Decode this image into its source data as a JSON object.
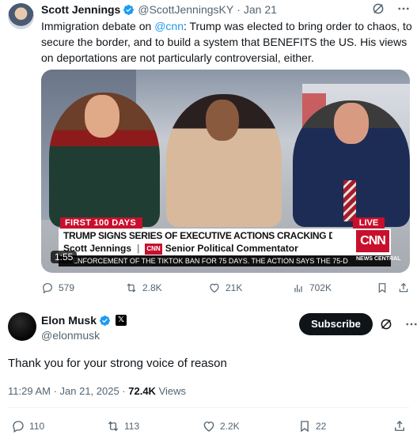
{
  "parent_tweet": {
    "name": "Scott Jennings",
    "handle": "@ScottJenningsKY",
    "separator": "·",
    "date": "Jan 21",
    "text_before_mention": "Immigration debate on ",
    "mention": "@cnn",
    "text_after_mention": ": Trump was elected to bring order to chaos, to secure the border, and to build a system that BENEFITS the US. His views on deportations are not particularly controversial, either.",
    "video": {
      "banner_left": "FIRST 100 DAYS",
      "banner_right": "LIVE",
      "headline": "TRUMP SIGNS SERIES OF EXECUTIVE ACTIONS CRACKING DOWN ON IMMIGRATION",
      "lower_name": "Scott Jennings",
      "lower_cnn_tag": "CNN",
      "lower_title": "Senior Political Commentator",
      "logo": "CNN",
      "ticker": "ENFORCEMENT OF THE TIKTOK BAN FOR 75 DAYS. THE ACTION SAYS THE 75-D",
      "ticker_tag": "NEWS CENTRAL",
      "duration": "1:55"
    },
    "stats": {
      "replies": "579",
      "reposts": "2.8K",
      "likes": "21K",
      "views": "702K"
    }
  },
  "reply_tweet": {
    "name": "Elon Musk",
    "x_badge": "𝕏",
    "handle": "@elonmusk",
    "subscribe_label": "Subscribe",
    "text": "Thank you for your strong voice of reason",
    "timestamp": "11:29 AM · Jan 21, 2025 · ",
    "views_count": "72.4K",
    "views_label": " Views",
    "stats": {
      "replies": "110",
      "reposts": "113",
      "likes": "2.2K",
      "bookmarks": "22"
    }
  },
  "colors": {
    "verified": "#1d9bf0",
    "link": "#1d9bf0",
    "muted": "#536471",
    "cnn_red": "#c8102e"
  }
}
